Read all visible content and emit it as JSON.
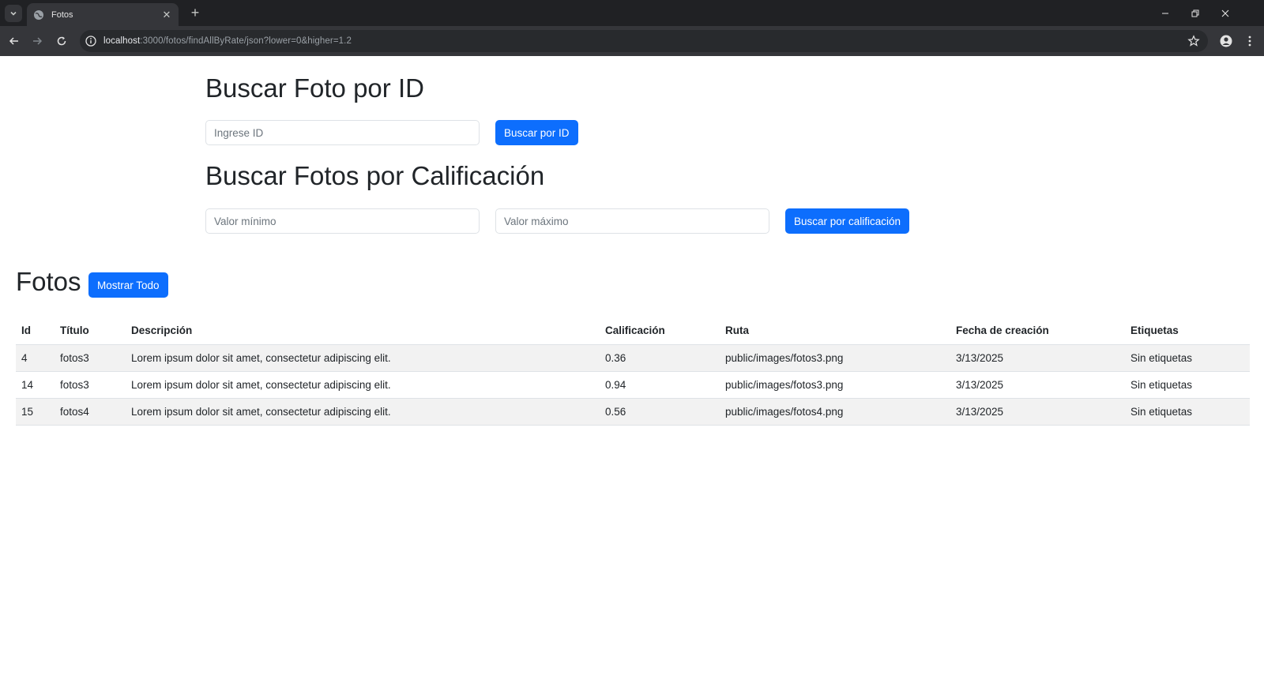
{
  "browser": {
    "tab_title": "Fotos",
    "url_host": "localhost",
    "url_rest": ":3000/fotos/findAllByRate/json?lower=0&higher=1.2"
  },
  "search_id": {
    "heading": "Buscar Foto por ID",
    "placeholder": "Ingrese ID",
    "button": "Buscar por ID"
  },
  "search_rate": {
    "heading": "Buscar Fotos por Calificación",
    "min_placeholder": "Valor mínimo",
    "max_placeholder": "Valor máximo",
    "button": "Buscar por calificación"
  },
  "photos": {
    "heading": "Fotos",
    "show_all_button": "Mostrar Todo",
    "columns": [
      "Id",
      "Título",
      "Descripción",
      "Calificación",
      "Ruta",
      "Fecha de creación",
      "Etiquetas"
    ],
    "rows": [
      [
        "4",
        "fotos3",
        "Lorem ipsum dolor sit amet, consectetur adipiscing elit.",
        "0.36",
        "public/images/fotos3.png",
        "3/13/2025",
        "Sin etiquetas"
      ],
      [
        "14",
        "fotos3",
        "Lorem ipsum dolor sit amet, consectetur adipiscing elit.",
        "0.94",
        "public/images/fotos3.png",
        "3/13/2025",
        "Sin etiquetas"
      ],
      [
        "15",
        "fotos4",
        "Lorem ipsum dolor sit amet, consectetur adipiscing elit.",
        "0.56",
        "public/images/fotos4.png",
        "3/13/2025",
        "Sin etiquetas"
      ]
    ]
  },
  "colors": {
    "primary": "#0d6efd",
    "striped_row": "#f2f2f2",
    "chrome_dark": "#202124",
    "chrome_toolbar": "#35363a"
  }
}
